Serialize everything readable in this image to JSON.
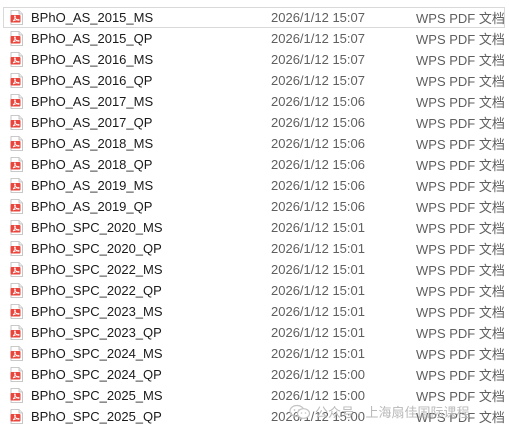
{
  "colors": {
    "pdf_icon_red": "#e8453c",
    "text": "#1a1a1a",
    "secondary_text": "#5f5f5f",
    "watermark": "#b9b9b9"
  },
  "files": [
    {
      "name": "BPhO_AS_2015_MS",
      "date": "2026/1/12 15:07",
      "type": "WPS PDF 文档"
    },
    {
      "name": "BPhO_AS_2015_QP",
      "date": "2026/1/12 15:07",
      "type": "WPS PDF 文档"
    },
    {
      "name": "BPhO_AS_2016_MS",
      "date": "2026/1/12 15:07",
      "type": "WPS PDF 文档"
    },
    {
      "name": "BPhO_AS_2016_QP",
      "date": "2026/1/12 15:07",
      "type": "WPS PDF 文档"
    },
    {
      "name": "BPhO_AS_2017_MS",
      "date": "2026/1/12 15:06",
      "type": "WPS PDF 文档"
    },
    {
      "name": "BPhO_AS_2017_QP",
      "date": "2026/1/12 15:06",
      "type": "WPS PDF 文档"
    },
    {
      "name": "BPhO_AS_2018_MS",
      "date": "2026/1/12 15:06",
      "type": "WPS PDF 文档"
    },
    {
      "name": "BPhO_AS_2018_QP",
      "date": "2026/1/12 15:06",
      "type": "WPS PDF 文档"
    },
    {
      "name": "BPhO_AS_2019_MS",
      "date": "2026/1/12 15:06",
      "type": "WPS PDF 文档"
    },
    {
      "name": "BPhO_AS_2019_QP",
      "date": "2026/1/12 15:06",
      "type": "WPS PDF 文档"
    },
    {
      "name": "BPhO_SPC_2020_MS",
      "date": "2026/1/12 15:01",
      "type": "WPS PDF 文档"
    },
    {
      "name": "BPhO_SPC_2020_QP",
      "date": "2026/1/12 15:01",
      "type": "WPS PDF 文档"
    },
    {
      "name": "BPhO_SPC_2022_MS",
      "date": "2026/1/12 15:01",
      "type": "WPS PDF 文档"
    },
    {
      "name": "BPhO_SPC_2022_QP",
      "date": "2026/1/12 15:01",
      "type": "WPS PDF 文档"
    },
    {
      "name": "BPhO_SPC_2023_MS",
      "date": "2026/1/12 15:01",
      "type": "WPS PDF 文档"
    },
    {
      "name": "BPhO_SPC_2023_QP",
      "date": "2026/1/12 15:01",
      "type": "WPS PDF 文档"
    },
    {
      "name": "BPhO_SPC_2024_MS",
      "date": "2026/1/12 15:01",
      "type": "WPS PDF 文档"
    },
    {
      "name": "BPhO_SPC_2024_QP",
      "date": "2026/1/12 15:00",
      "type": "WPS PDF 文档"
    },
    {
      "name": "BPhO_SPC_2025_MS",
      "date": "2026/1/12 15:00",
      "type": "WPS PDF 文档"
    },
    {
      "name": "BPhO_SPC_2025_QP",
      "date": "2026/1/12 15:00",
      "type": "WPS PDF 文档"
    }
  ],
  "selected_file": "BPhO_AS_2015_MS",
  "watermark": {
    "text": "公众号 · 上海扇佳国际课程",
    "icon": "wechat-icon"
  }
}
